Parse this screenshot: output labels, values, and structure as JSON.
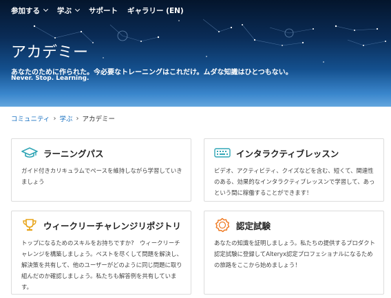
{
  "nav": {
    "items": [
      {
        "label": "参加する",
        "has_menu": true
      },
      {
        "label": "学ぶ",
        "has_menu": true
      },
      {
        "label": "サポート",
        "has_menu": false
      },
      {
        "label": "ギャラリー (EN)",
        "has_menu": false
      }
    ]
  },
  "hero": {
    "title": "アカデミー",
    "subtitle": "あなたのために作られた。今必要なトレーニングはこれだけ。ムダな知識はひとつもない。",
    "tagline": "Never. Stop. Learning."
  },
  "breadcrumb": {
    "items": [
      "コミュニティ",
      "学ぶ"
    ],
    "current": "アカデミー"
  },
  "cards": [
    {
      "title": "ラーニングパス",
      "icon": "graduation-cap-icon",
      "description": "ガイド付きカリキュラムでペースを維持しながら学習していきましょう"
    },
    {
      "title": "インタラクティブレッスン",
      "icon": "keyboard-icon",
      "description": "ビデオ、アクティビティ、クイズなどを含む、短くて、関連性のある、効果的なインタラクティブレッスンで学習して、あっという間に稼働することができます！"
    },
    {
      "title": "ウィークリーチャレンジリポジトリ",
      "icon": "trophy-icon",
      "description": "トップになるためのスキルをお持ちですか?　ウィークリーチャレンジを構築しましょう。ベストを尽くして問題を解決し、解決策を共有して、他のユーザーがどのように同じ問題に取り組んだのか確認しましょう。私たちも解答例を共有しています。"
    },
    {
      "title": "認定試験",
      "icon": "certification-badge-icon",
      "description": "あなたの知識を証明しましょう。私たちの提供するプロダクト認定試験に登録してAlteryx認定プロフェショナルになるための旅路をここから始めましょう！"
    }
  ],
  "colors": {
    "accent": "#1a72c2",
    "icon_gold": "#e8a317",
    "icon_orange": "#ef7a22",
    "icon_teal": "#2fa5b5"
  }
}
